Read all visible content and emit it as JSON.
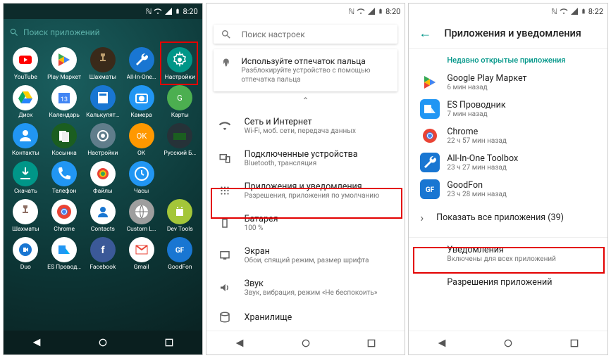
{
  "status": {
    "time": "8:20",
    "time3": "8:22"
  },
  "screen1": {
    "search_placeholder": "Поиск приложений",
    "apps": [
      {
        "label": "YouTube",
        "bg": "#fff",
        "glyph": "yt"
      },
      {
        "label": "Play Маркет",
        "bg": "#fff",
        "glyph": "play"
      },
      {
        "label": "Шахматы",
        "bg": "#3a2a1a",
        "glyph": "chess"
      },
      {
        "label": "All-In-One…",
        "bg": "#1976d2",
        "glyph": "wrench"
      },
      {
        "label": "Настройки",
        "bg": "#009688",
        "glyph": "gear"
      },
      {
        "label": "Диск",
        "bg": "#fff",
        "glyph": "drive"
      },
      {
        "label": "Календарь",
        "bg": "#fff",
        "glyph": "cal"
      },
      {
        "label": "Калькулят…",
        "bg": "#1976d2",
        "glyph": "calc"
      },
      {
        "label": "Камера",
        "bg": "#2196f3",
        "glyph": "cam"
      },
      {
        "label": "Карты",
        "bg": "#4caf50",
        "glyph": "map"
      },
      {
        "label": "Контакты",
        "bg": "#2196f3",
        "glyph": "person"
      },
      {
        "label": "Косынка",
        "bg": "#1b5e20",
        "glyph": "cards"
      },
      {
        "label": "Настройки",
        "bg": "#607d8b",
        "glyph": "gear2"
      },
      {
        "label": "OK",
        "bg": "#ff9800",
        "glyph": "ok"
      },
      {
        "label": "Русский Б…",
        "bg": "#263238",
        "glyph": "bil"
      },
      {
        "label": "Скачать",
        "bg": "#009688",
        "glyph": "dl"
      },
      {
        "label": "Телефон",
        "bg": "#2196f3",
        "glyph": "phone"
      },
      {
        "label": "Файлы",
        "bg": "#fff",
        "glyph": "photos"
      },
      {
        "label": "Часы",
        "bg": "#2196f3",
        "glyph": "clock"
      },
      {
        "label": "",
        "bg": "transparent",
        "glyph": ""
      },
      {
        "label": "Шахматы",
        "bg": "#fff",
        "glyph": "chess2"
      },
      {
        "label": "Chrome",
        "bg": "#fff",
        "glyph": "chrome"
      },
      {
        "label": "Contacts",
        "bg": "#fff",
        "glyph": "person2"
      },
      {
        "label": "Custom L…",
        "bg": "#9e9e9e",
        "glyph": "locale"
      },
      {
        "label": "Dev Tools",
        "bg": "#a4c639",
        "glyph": "droid"
      },
      {
        "label": "Duo",
        "bg": "#fff",
        "glyph": "duo"
      },
      {
        "label": "ES Провод…",
        "bg": "#fff",
        "glyph": "es"
      },
      {
        "label": "Facebook",
        "bg": "#3b5998",
        "glyph": "fb"
      },
      {
        "label": "Gmail",
        "bg": "#fff",
        "glyph": "gmail"
      },
      {
        "label": "GoodFon",
        "bg": "#1976d2",
        "glyph": "gf"
      }
    ]
  },
  "screen2": {
    "search_placeholder": "Поиск настроек",
    "fingerprint": {
      "title": "Используйте отпечаток пальца",
      "sub": "Разблокируйте устройство с помощью отпечатка пальца"
    },
    "rows": [
      {
        "icon": "wifi",
        "title": "Сеть и Интернет",
        "sub": "Wi-Fi, моб. сети, передача данных"
      },
      {
        "icon": "devices",
        "title": "Подключенные устройства",
        "sub": "Bluetooth, трансляция"
      },
      {
        "icon": "apps",
        "title": "Приложения и уведомления",
        "sub": "Разрешения, приложения по умолчанию"
      },
      {
        "icon": "battery",
        "title": "Батарея",
        "sub": "100 %"
      },
      {
        "icon": "display",
        "title": "Экран",
        "sub": "Обои, спящий режим, размер шрифта"
      },
      {
        "icon": "sound",
        "title": "Звук",
        "sub": "Звук, вибрация, режим «Не беспокоить»"
      },
      {
        "icon": "storage",
        "title": "Хранилище",
        "sub": ""
      }
    ]
  },
  "screen3": {
    "title": "Приложения и уведомления",
    "section": "Недавно открытые приложения",
    "recent": [
      {
        "name": "Google Play Маркет",
        "sub": "6 мин назад",
        "bg": "#fff",
        "glyph": "play"
      },
      {
        "name": "ES Проводник",
        "sub": "7 мин назад",
        "bg": "#2196f3",
        "glyph": "es2"
      },
      {
        "name": "Chrome",
        "sub": "22 ч 57 мин назад",
        "bg": "#fff",
        "glyph": "chrome"
      },
      {
        "name": "All-In-One Toolbox",
        "sub": "23 ч 27 мин назад",
        "bg": "#1976d2",
        "glyph": "wrench"
      },
      {
        "name": "GoodFon",
        "sub": "23 ч 28 мин назад",
        "bg": "#1976d2",
        "glyph": "gf"
      }
    ],
    "show_all": "Показать все приложения (39)",
    "notifications": {
      "title": "Уведомления",
      "sub": "Включены для всех приложений"
    },
    "permissions": {
      "title": "Разрешения приложений"
    }
  }
}
